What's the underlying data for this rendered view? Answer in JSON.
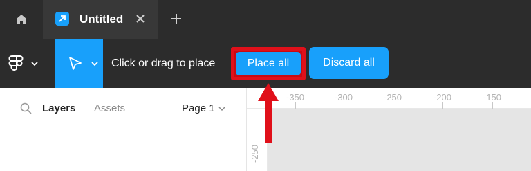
{
  "tabbar": {
    "home_icon": "home-icon",
    "tab_title": "Untitled",
    "close_icon": "close-icon",
    "new_tab_icon": "plus-icon"
  },
  "toolbar": {
    "hint": "Click or drag to place",
    "place_all": "Place all",
    "discard_all": "Discard all",
    "accent": "#18a0fb",
    "highlight": "#e0101a"
  },
  "panel": {
    "layers_tab": "Layers",
    "assets_tab": "Assets",
    "page_select": "Page 1"
  },
  "rulers": {
    "top": [
      "-350",
      "-300",
      "-250",
      "-200",
      "-150"
    ],
    "left": [
      "-250"
    ]
  }
}
